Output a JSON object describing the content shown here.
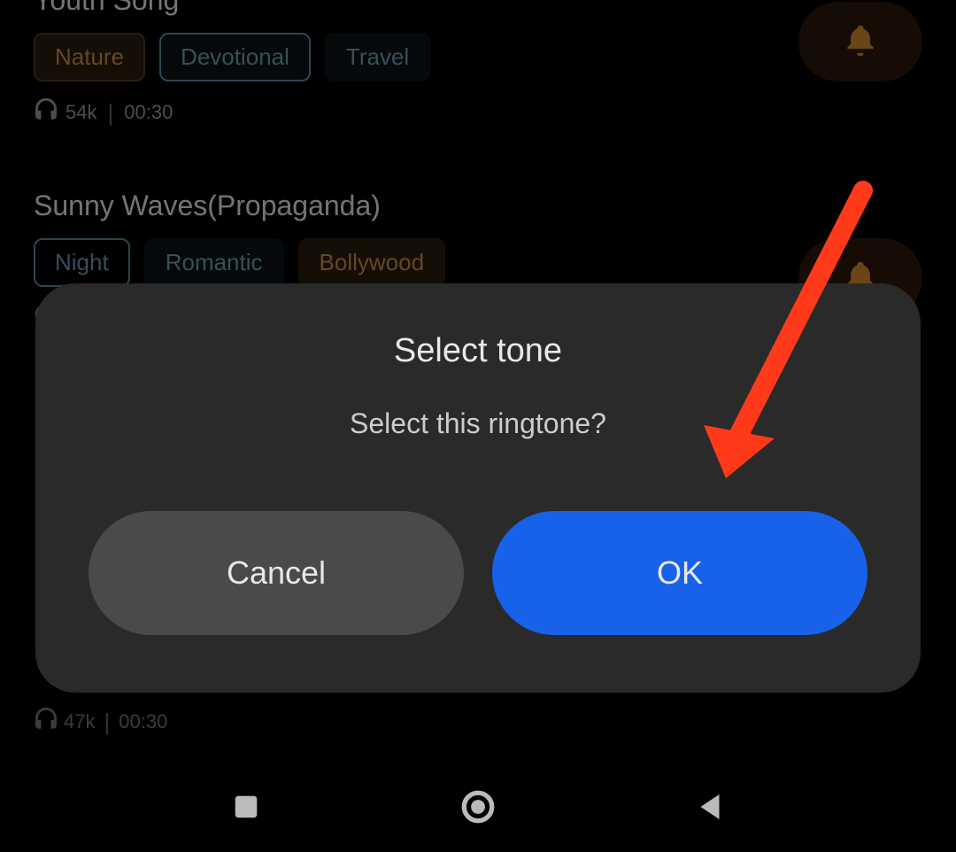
{
  "songs": [
    {
      "title": "Youth Song",
      "tags": {
        "t1": "Nature",
        "t2": "Devotional",
        "t3": "Travel"
      },
      "plays": "54k",
      "duration": "00:30"
    },
    {
      "title": "Sunny Waves(Propaganda)",
      "tags": {
        "t1": "Night",
        "t2": "Romantic",
        "t3": "Bollywood"
      }
    }
  ],
  "bottom_meta": {
    "plays": "47k",
    "duration": "00:30"
  },
  "dialog": {
    "title": "Select tone",
    "message": "Select this ringtone?",
    "cancel": "Cancel",
    "ok": "OK"
  }
}
